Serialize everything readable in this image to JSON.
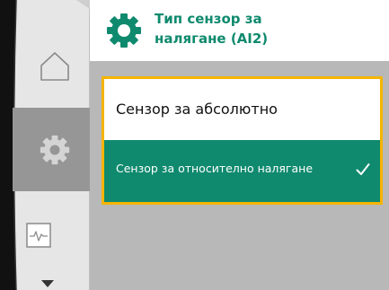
{
  "header": {
    "title_line1": "Тип сензор за",
    "title_line2": "налягане (AI2)",
    "icon": "gear-icon"
  },
  "sidebar": {
    "items": [
      {
        "name": "home",
        "icon": "home-icon"
      },
      {
        "name": "settings",
        "icon": "gear-icon",
        "selected": true
      },
      {
        "name": "diagnostics",
        "icon": "pulse-icon"
      }
    ]
  },
  "menu": {
    "options": [
      {
        "label": "Сензор за абсолютно",
        "selected": false
      },
      {
        "label": "Сензор за относително налягане",
        "selected": true,
        "icon": "checkmark-icon"
      }
    ]
  },
  "colors": {
    "accent": "#0f8a6e",
    "focus_border": "#f5b400",
    "background": "#b8b8b8",
    "sidebar_selected": "#969696"
  }
}
